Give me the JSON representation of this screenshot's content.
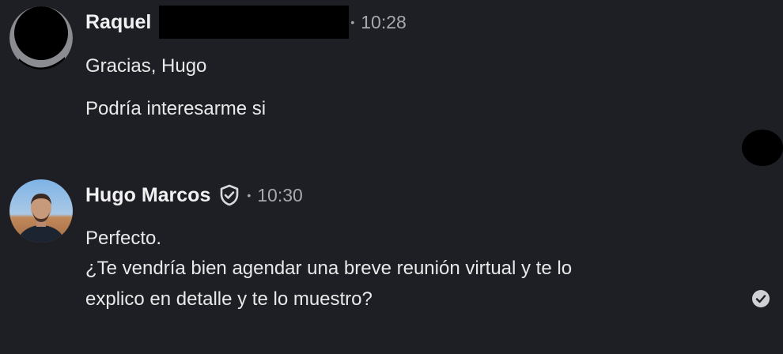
{
  "messages": [
    {
      "sender": "Raquel",
      "timestamp": "10:28",
      "separator": "•",
      "lines": [
        "Gracias, Hugo",
        "Podría interesarme si"
      ]
    },
    {
      "sender": "Hugo Marcos",
      "timestamp": "10:30",
      "separator": "•",
      "verified": true,
      "lines": [
        "Perfecto.",
        "¿Te vendría bien agendar una breve reunión virtual y te lo",
        "explico en detalle y te lo muestro?"
      ],
      "read": true
    }
  ],
  "icons": {
    "verified": "shield-check-icon",
    "read_receipt": "check-circle-icon"
  },
  "colors": {
    "background": "#1d1f24",
    "text": "#e9e9ea",
    "muted": "#a8a9ad"
  }
}
